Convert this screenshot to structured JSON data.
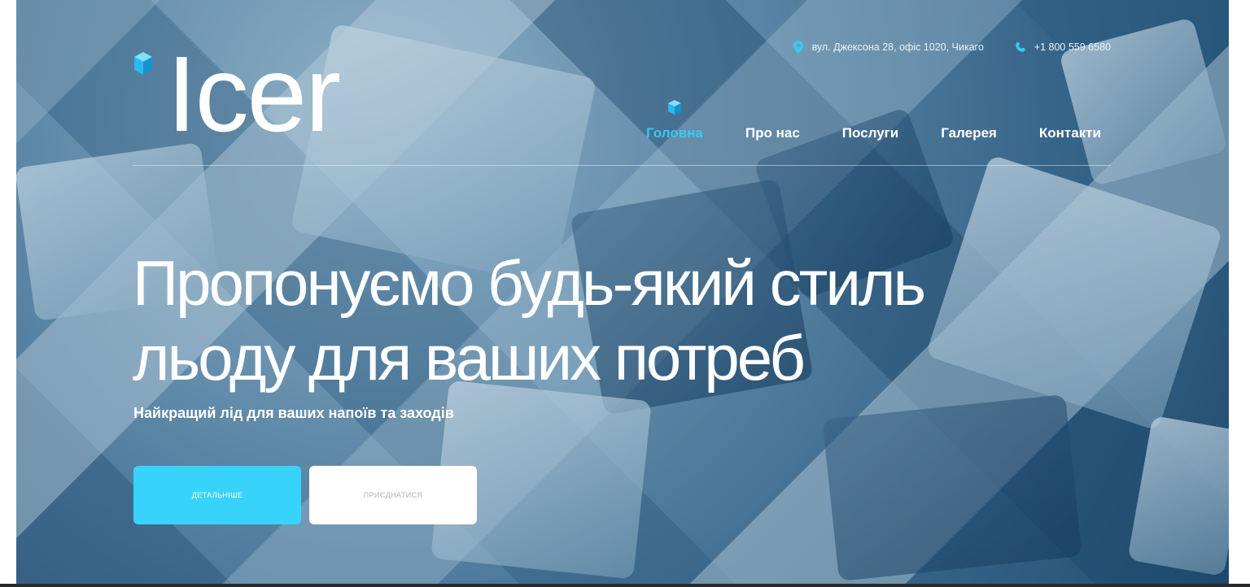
{
  "brand": {
    "logo_text": "Icer",
    "logo_icon": "ice-cube-icon",
    "accent_color": "#38c9f5",
    "button_color": "#38d3fb"
  },
  "contact": {
    "address": "вул. Джексона 28, офіс 1020, Чикаго",
    "address_icon": "map-pin-icon",
    "phone": "+1 800 559 6580",
    "phone_icon": "phone-icon"
  },
  "nav": {
    "items": [
      {
        "label": "Головна",
        "active": true
      },
      {
        "label": "Про нас",
        "active": false
      },
      {
        "label": "Послуги",
        "active": false
      },
      {
        "label": "Галерея",
        "active": false
      },
      {
        "label": "Контакти",
        "active": false
      }
    ]
  },
  "hero": {
    "headline_line1": "Пропонуємо будь-який стиль",
    "headline_line2": "льоду для ваших потреб",
    "subtitle": "Найкращий лід для ваших напоїв та заходів",
    "primary_button": "ДЕТАЛЬНІШЕ",
    "secondary_button": "ПРИЄДНАТИСЯ"
  }
}
